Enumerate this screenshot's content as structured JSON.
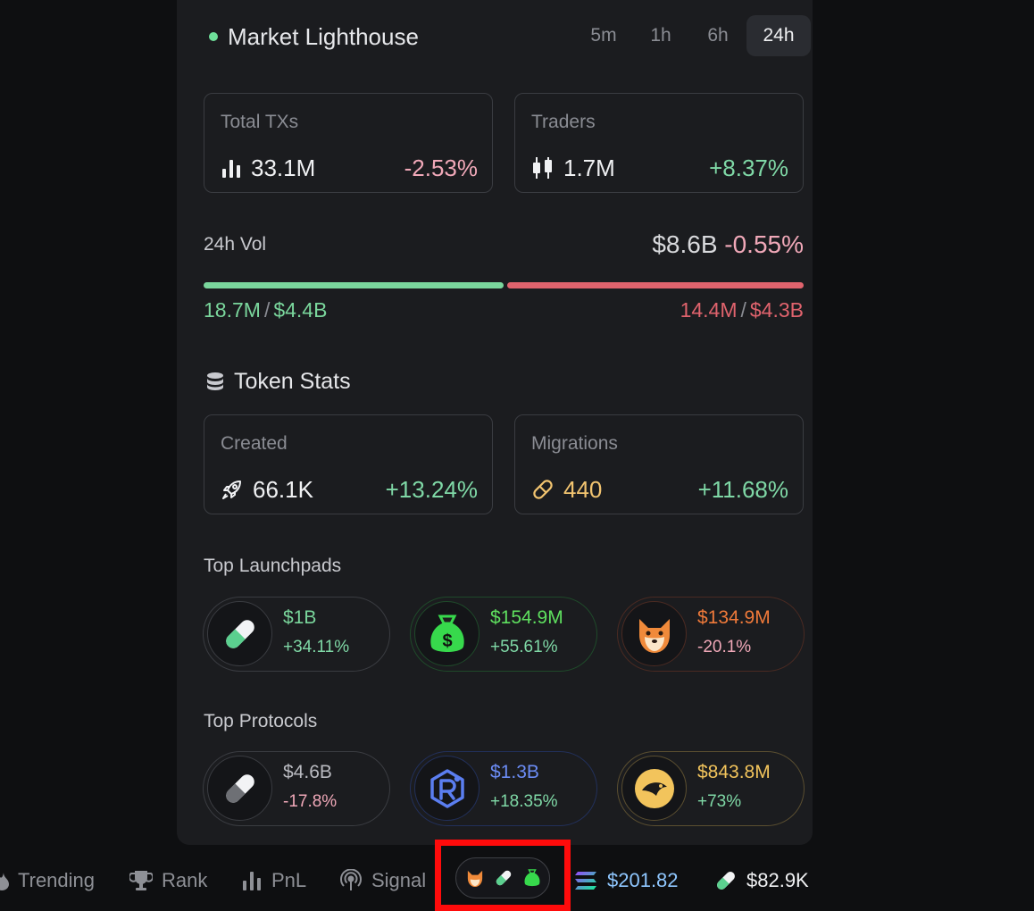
{
  "header": {
    "title": "Market Lighthouse",
    "tabs": [
      "5m",
      "1h",
      "6h",
      "24h"
    ],
    "selected_tab": "24h"
  },
  "stats": {
    "total_txs": {
      "label": "Total TXs",
      "value": "33.1M",
      "change": "-2.53%"
    },
    "traders": {
      "label": "Traders",
      "value": "1.7M",
      "change": "+8.37%"
    }
  },
  "volume": {
    "label": "24h Vol",
    "total": "$8.6B",
    "change": "-0.55%",
    "buy_count": "18.7M",
    "buy_amount": "$4.4B",
    "sell_count": "14.4M",
    "sell_amount": "$4.3B",
    "separator": "/"
  },
  "token_stats": {
    "title": "Token Stats",
    "created": {
      "label": "Created",
      "value": "66.1K",
      "change": "+13.24%"
    },
    "migrations": {
      "label": "Migrations",
      "value": "440",
      "change": "+11.68%"
    }
  },
  "launchpads": {
    "title": "Top Launchpads",
    "items": [
      {
        "amount": "$1B",
        "change": "+34.11%",
        "icon": "pill-icon",
        "color": "#7ad69c"
      },
      {
        "amount": "$154.9M",
        "change": "+55.61%",
        "icon": "money-bag-icon",
        "color": "#5fe05f"
      },
      {
        "amount": "$134.9M",
        "change": "-20.1%",
        "icon": "shiba-icon",
        "color": "#f07a3a"
      }
    ]
  },
  "protocols": {
    "title": "Top Protocols",
    "items": [
      {
        "amount": "$4.6B",
        "change": "-17.8%",
        "icon": "pill-gray-icon",
        "color": "#b9bac0"
      },
      {
        "amount": "$1.3B",
        "change": "+18.35%",
        "icon": "raydium-icon",
        "color": "#6b8cf5"
      },
      {
        "amount": "$843.8M",
        "change": "+73%",
        "icon": "bird-coin-icon",
        "color": "#f2c45c"
      }
    ]
  },
  "bottom_bar": {
    "items": [
      "Trending",
      "Rank",
      "PnL",
      "Signal"
    ],
    "sol_price": "$201.82",
    "pill_value": "$82.9K"
  },
  "colors": {
    "green": "#7ad69c",
    "red": "#e0636d",
    "pink": "#f0a8b8",
    "highlight": "#ff0b0b"
  }
}
